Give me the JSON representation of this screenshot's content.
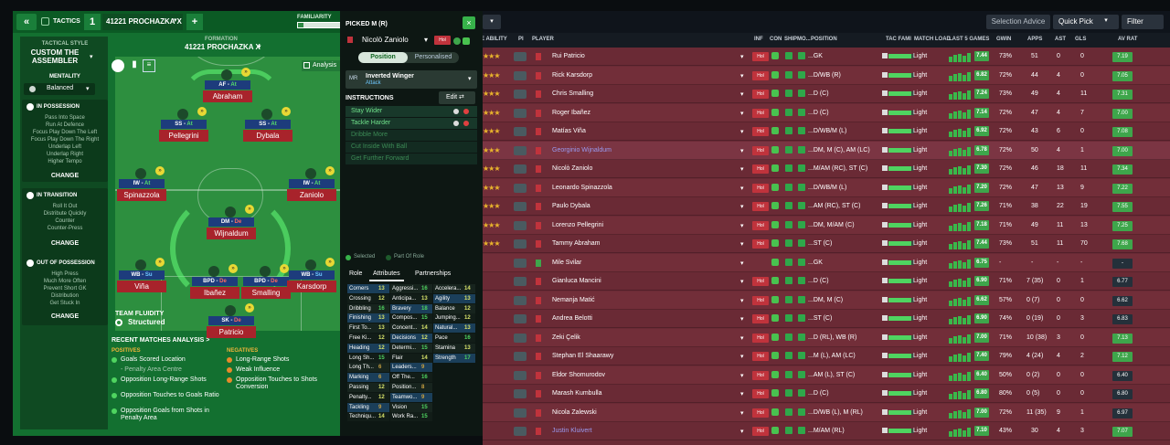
{
  "tactics": {
    "tab": "TACTICS",
    "num": "1",
    "name": "41221 PROCHAZKA X",
    "fam": "FAMILIARITY",
    "style_label": "TACTICAL STYLE",
    "style": "CUSTOM THE ASSEMBLER",
    "mentality_label": "MENTALITY",
    "mentality": "Balanced",
    "in_poss": "IN POSSESSION",
    "in_poss_items": [
      "Pass Into Space",
      "Run At Defence",
      "Focus Play Down The Left",
      "Focus Play Down The Right",
      "Underlap Left",
      "Underlap Right",
      "Higher Tempo"
    ],
    "in_trans": "IN TRANSITION",
    "in_trans_items": [
      "Roll It Out",
      "Distribute Quickly",
      "Counter",
      "Counter-Press"
    ],
    "out_poss": "OUT OF POSSESSION",
    "out_poss_items": [
      "High Press",
      "Much More Often",
      "Prevent Short GK",
      "Distribution",
      "Get Stuck In"
    ],
    "change": "CHANGE",
    "formation_label": "FORMATION",
    "formation": "41221 PROCHAZKA X",
    "analysis": "Analysis",
    "fluidity_label": "TEAM FLUIDITY",
    "fluidity": "Structured",
    "recent": "RECENT MATCHES ANALYSIS",
    "positives": "POSITIVES",
    "positives_items": [
      "Goals Scored Location",
      "- Penalty Area Centre",
      "Opposition Long-Range Shots",
      "Opposition Touches to Goals Ratio",
      "Opposition Goals from Shots in Penalty Area"
    ],
    "negatives": "NEGATIVES",
    "negatives_items": [
      "Long-Range Shots",
      "Weak Influence",
      "Opposition Touches to Shots Conversion"
    ],
    "players": [
      {
        "role": "AF",
        "duty": "At",
        "name": "Abraham"
      },
      {
        "role": "SS",
        "duty": "At",
        "name": "Pellegrini"
      },
      {
        "role": "SS",
        "duty": "At",
        "name": "Dybala"
      },
      {
        "role": "IW",
        "duty": "At",
        "name": "Spinazzola"
      },
      {
        "role": "IW",
        "duty": "At",
        "name": "Zaniolo"
      },
      {
        "role": "DM",
        "duty": "De",
        "name": "Wijnaldum"
      },
      {
        "role": "WB",
        "duty": "Su",
        "name": "Viña"
      },
      {
        "role": "BPD",
        "duty": "De",
        "name": "Ibañez"
      },
      {
        "role": "BPD",
        "duty": "De",
        "name": "Smalling"
      },
      {
        "role": "WB",
        "duty": "Su",
        "name": "Karsdorp"
      },
      {
        "role": "SK",
        "duty": "De",
        "name": "Patricio"
      }
    ]
  },
  "picked": {
    "title": "PICKED M (R)",
    "player": "Nicolò Zaniolo",
    "position_tab": "Position",
    "personalised_tab": "Personalised",
    "pos_code": "MR",
    "role": "Inverted Winger",
    "duty": "Attack",
    "instructions": "INSTRUCTIONS",
    "edit": "Edit",
    "instr_items": [
      "Stay Wider",
      "Tackle Harder",
      "Dribble More",
      "Cut Inside With Ball",
      "Get Further Forward"
    ],
    "legend_selected": "Selected",
    "legend_part": "Part Of Role",
    "tabs": [
      "Role",
      "Attributes",
      "Partnerships"
    ],
    "attrs": [
      [
        "Corners",
        "13",
        "Aggressi...",
        "16",
        "Accelera...",
        "14"
      ],
      [
        "Crossing",
        "12",
        "Anticipa...",
        "13",
        "Agility",
        "13"
      ],
      [
        "Dribbling",
        "16",
        "Bravery",
        "18",
        "Balance",
        "12"
      ],
      [
        "Finishing",
        "13",
        "Compos...",
        "15",
        "Jumping...",
        "12"
      ],
      [
        "First To...",
        "13",
        "Concent...",
        "14",
        "Natural...",
        "13"
      ],
      [
        "Free Ki...",
        "12",
        "Decisions",
        "12",
        "Pace",
        "16"
      ],
      [
        "Heading",
        "12",
        "Determi...",
        "15",
        "Stamina",
        "13"
      ],
      [
        "Long Sh...",
        "15",
        "Flair",
        "14",
        "Strength",
        "17"
      ],
      [
        "Long Th...",
        "6",
        "Leaders...",
        "9",
        "",
        ""
      ],
      [
        "Marking",
        "6",
        "Off The...",
        "16",
        "",
        ""
      ],
      [
        "Passing",
        "12",
        "Position...",
        "8",
        "",
        ""
      ],
      [
        "Penalty...",
        "12",
        "Teamwo...",
        "9",
        "",
        ""
      ],
      [
        "Tackling",
        "9",
        "Vision",
        "15",
        "",
        ""
      ],
      [
        "Techniqu...",
        "14",
        "Work Ra...",
        "15",
        "",
        ""
      ]
    ]
  },
  "table": {
    "sel_advice": "Selection Advice",
    "quick_pick": "Quick Pick",
    "filter": "Filter",
    "headers": {
      "ability": "E ABILITY",
      "pi": "PI",
      "player": "PLAYER",
      "inf": "INF",
      "con": "CON",
      "ship": "SHIP",
      "mo": "MO...",
      "position": "POSITION",
      "tacfam": "TAC FAMI",
      "load": "MATCH LOAD",
      "last5": "LAST 5 GAMES",
      "gwin": "GWIN",
      "apps": "APPS",
      "ast": "AST",
      "gls": "GLS",
      "avrat": "AV RAT"
    },
    "rows": [
      {
        "name": "Rui Patricio",
        "pos": "GK",
        "load": "Light",
        "rat": "7.44",
        "gwin": "73%",
        "apps": "51",
        "ast": "0",
        "gls": "0",
        "av": "7.19",
        "stars": 3,
        "lk": "Hol",
        "f": 0.9
      },
      {
        "name": "Rick Karsdorp",
        "pos": "D/WB (R)",
        "load": "Light",
        "rat": "6.82",
        "gwin": "72%",
        "apps": "44",
        "ast": "4",
        "gls": "0",
        "av": "7.05",
        "stars": 3,
        "lk": "Hol",
        "f": 0.9
      },
      {
        "name": "Chris Smalling",
        "pos": "D (C)",
        "load": "Light",
        "rat": "7.24",
        "gwin": "73%",
        "apps": "49",
        "ast": "4",
        "gls": "11",
        "av": "7.31",
        "stars": 3,
        "lk": "Hol",
        "f": 0.9
      },
      {
        "name": "Roger Ibañez",
        "pos": "D (C)",
        "load": "Light",
        "rat": "7.14",
        "gwin": "72%",
        "apps": "47",
        "ast": "4",
        "gls": "7",
        "av": "7.00",
        "stars": 3,
        "lk": "Hol",
        "f": 0.9
      },
      {
        "name": "Matías Viña",
        "pos": "D/WB/M (L)",
        "load": "Light",
        "rat": "6.92",
        "gwin": "72%",
        "apps": "43",
        "ast": "6",
        "gls": "0",
        "av": "7.08",
        "stars": 3,
        "lk": "Hol",
        "f": 0.9
      },
      {
        "name": "Georginio Wijnaldum",
        "pos": "DM, M (C), AM (LC)",
        "load": "Light",
        "rat": "6.78",
        "gwin": "72%",
        "apps": "50",
        "ast": "4",
        "gls": "1",
        "av": "7.00",
        "stars": 3,
        "lk": "Hol",
        "f": 0.9
      },
      {
        "name": "Nicolò Zaniolo",
        "pos": "M/AM (RC), ST (C)",
        "load": "Light",
        "rat": "7.30",
        "gwin": "72%",
        "apps": "46",
        "ast": "18",
        "gls": "11",
        "av": "7.34",
        "stars": 3,
        "lk": "Hol",
        "f": 0.9
      },
      {
        "name": "Leonardo Spinazzola",
        "pos": "D/WB/M (L)",
        "load": "Light",
        "rat": "7.20",
        "gwin": "72%",
        "apps": "47",
        "ast": "13",
        "gls": "9",
        "av": "7.22",
        "stars": 3,
        "lk": "Hol",
        "f": 0.9
      },
      {
        "name": "Paulo Dybala",
        "pos": "AM (RC), ST (C)",
        "load": "Light",
        "rat": "7.26",
        "gwin": "71%",
        "apps": "38",
        "ast": "22",
        "gls": "19",
        "av": "7.55",
        "stars": 3,
        "lk": "Hol",
        "f": 0.9
      },
      {
        "name": "Lorenzo Pellegrini",
        "pos": "DM, M/AM (C)",
        "load": "Light",
        "rat": "7.18",
        "gwin": "71%",
        "apps": "49",
        "ast": "11",
        "gls": "13",
        "av": "7.25",
        "stars": 3,
        "lk": "Hol",
        "f": 0.9
      },
      {
        "name": "Tammy Abraham",
        "pos": "ST (C)",
        "load": "Light",
        "rat": "7.44",
        "gwin": "73%",
        "apps": "51",
        "ast": "11",
        "gls": "70",
        "av": "7.68",
        "stars": 3,
        "lk": "Hol",
        "f": 0.9
      },
      {
        "name": "Mile Svilar",
        "pos": "GK",
        "load": "Light",
        "rat": "6.75",
        "gwin": "-",
        "apps": "-",
        "ast": "-",
        "gls": "-",
        "av": "-",
        "stars": 0,
        "lk": "",
        "f": 0.9
      },
      {
        "name": "Gianluca Mancini",
        "pos": "D (C)",
        "load": "Light",
        "rat": "6.90",
        "gwin": "71%",
        "apps": "7 (35)",
        "ast": "0",
        "gls": "1",
        "av": "6.77",
        "stars": 0,
        "lk": "Hol",
        "f": 0.9
      },
      {
        "name": "Nemanja Matić",
        "pos": "DM, M (C)",
        "load": "Light",
        "rat": "6.62",
        "gwin": "57%",
        "apps": "0 (7)",
        "ast": "0",
        "gls": "0",
        "av": "6.62",
        "stars": 0,
        "lk": "Hol",
        "f": 0.9
      },
      {
        "name": "Andrea Belotti",
        "pos": "ST (C)",
        "load": "Light",
        "rat": "6.90",
        "gwin": "74%",
        "apps": "0 (19)",
        "ast": "0",
        "gls": "3",
        "av": "6.83",
        "stars": 0,
        "lk": "Hol",
        "f": 0.9
      },
      {
        "name": "Zeki Çelik",
        "pos": "D (RL), WB (R)",
        "load": "Light",
        "rat": "7.00",
        "gwin": "71%",
        "apps": "10 (38)",
        "ast": "3",
        "gls": "0",
        "av": "7.13",
        "stars": 0,
        "lk": "Hol",
        "f": 0.9
      },
      {
        "name": "Stephan El Shaarawy",
        "pos": "M (L), AM (LC)",
        "load": "Light",
        "rat": "7.40",
        "gwin": "79%",
        "apps": "4 (24)",
        "ast": "4",
        "gls": "2",
        "av": "7.12",
        "stars": 0,
        "lk": "Hol",
        "f": 0.9
      },
      {
        "name": "Eldor Shomurodov",
        "pos": "AM (L), ST (C)",
        "load": "Light",
        "rat": "6.40",
        "gwin": "50%",
        "apps": "0 (2)",
        "ast": "0",
        "gls": "0",
        "av": "6.40",
        "stars": 0,
        "lk": "Hol",
        "f": 0.9
      },
      {
        "name": "Marash Kumbulla",
        "pos": "D (C)",
        "load": "Light",
        "rat": "6.80",
        "gwin": "80%",
        "apps": "0 (5)",
        "ast": "0",
        "gls": "0",
        "av": "6.80",
        "stars": 0,
        "lk": "Hol",
        "f": 0.9
      },
      {
        "name": "Nicola Zalewski",
        "pos": "D/WB (L), M (RL)",
        "load": "Light",
        "rat": "7.00",
        "gwin": "72%",
        "apps": "11 (35)",
        "ast": "9",
        "gls": "1",
        "av": "6.97",
        "stars": 0,
        "lk": "Hol",
        "f": 0.9
      },
      {
        "name": "Justin Kluivert",
        "pos": "M/AM (RL)",
        "load": "Light",
        "rat": "7.10",
        "gwin": "43%",
        "apps": "30",
        "ast": "4",
        "gls": "3",
        "av": "7.07",
        "stars": 0,
        "lk": "Hol",
        "f": 0.9
      }
    ]
  }
}
